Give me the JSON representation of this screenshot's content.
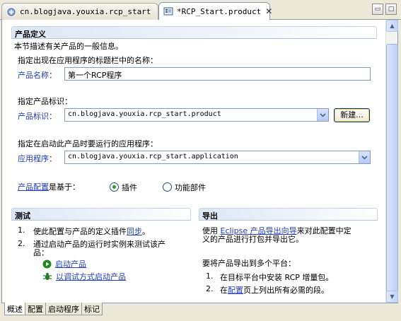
{
  "tabs": [
    {
      "label": "cn.blogjava.youxia.rcp_start",
      "active": false
    },
    {
      "label": "*RCP_Start.product",
      "active": true
    }
  ],
  "window_buttons": {
    "minimize": "▭",
    "maximize": "□"
  },
  "product_definition": {
    "title": "产品定义",
    "description": "本节描述有关产品的一般信息。",
    "name_prompt": "指定出现在应用程序的标题栏中的名称：",
    "name_label": "产品名称：",
    "name_value": "第一个RCP程序",
    "id_prompt": "指定产品标识：",
    "id_label": "产品标识：",
    "id_value": "cn.blogjava.youxia.rcp_start.product",
    "new_button": "新建...",
    "app_prompt": "指定在启动此产品时要运行的应用程序：",
    "app_label": "应用程序：",
    "app_value": "cn.blogjava.youxia.rcp_start.application",
    "config_link": "产品配置",
    "config_suffix": "是基于：",
    "radio_plugins": "插件",
    "radio_features": "功能部件",
    "selected": "插件"
  },
  "testing": {
    "title": "测试",
    "step1_num": "1.",
    "step1_prefix": "使此配置与产品的定义插件",
    "step1_link": "同步",
    "step1_suffix": "。",
    "step2_num": "2.",
    "step2_line1": "通过启动产品的运行时实例来测试该产",
    "step2_line2": "品：",
    "launch_link": "启动产品",
    "debug_link": "以调试方式启动产品"
  },
  "export": {
    "title": "导出",
    "line1_prefix": "使用",
    "line1_link": "Eclipse 产品导出向导",
    "line1_suffix": "来对此配置中定",
    "line2": "义的产品进行打包并导出它。",
    "multi_title": "要将产品导出到多个平台：",
    "step1_num": "1.",
    "step1": "在目标平台中安装 RCP 增量包。",
    "step2_num": "2.",
    "step2_prefix": "在",
    "step2_link": "配置",
    "step2_suffix": "页上列出所有必需的段。"
  },
  "page_tabs": [
    {
      "label": "概述",
      "active": true
    },
    {
      "label": "配置",
      "active": false
    },
    {
      "label": "启动程序",
      "active": false
    },
    {
      "label": "标记",
      "active": false
    }
  ],
  "colors": {
    "label_blue": "#1f3dbc",
    "radio_green": "#21a121",
    "launch_green": "#1e8a1e"
  }
}
